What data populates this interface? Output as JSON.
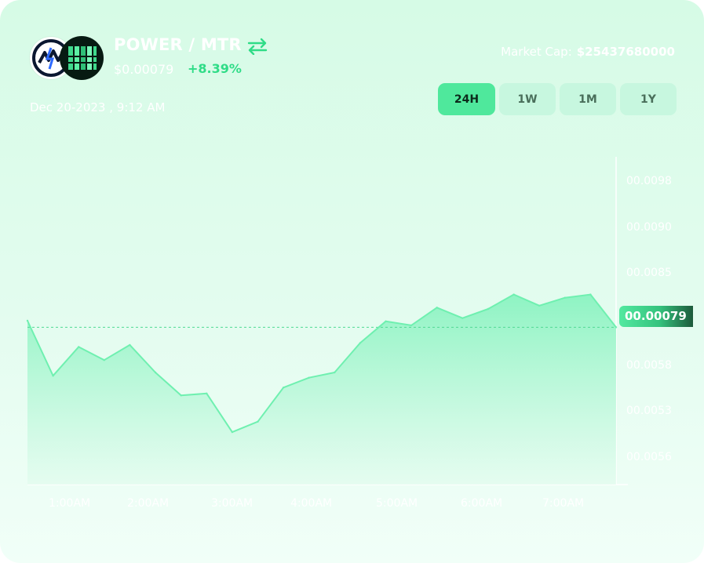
{
  "header": {
    "pair": "POWER / MTR",
    "price": "$0.00079",
    "change": "+8.39%",
    "date": "Dec 20-2023 , 9:12 AM",
    "market_cap_label": "Market Cap:",
    "market_cap_value": "$25437680000"
  },
  "icons": {
    "swap": "swap-arrows-icon",
    "token_a": "meter-token-icon",
    "token_b": "power-token-icon"
  },
  "timeframes": [
    {
      "label": "24H",
      "active": true
    },
    {
      "label": "1W",
      "active": false
    },
    {
      "label": "1M",
      "active": false
    },
    {
      "label": "1Y",
      "active": false
    }
  ],
  "colors": {
    "accent": "#2fdc87",
    "line": "#6ff0b0",
    "area_top": "#7ff2bb",
    "area_bottom": "#dffbec",
    "active_tab": "#4fe89c",
    "inactive_tab": "#c7f7df"
  },
  "chart_data": {
    "type": "area",
    "y_ticks": [
      "00.0098",
      "00.0090",
      "00.0085",
      "00.0058",
      "00.0053",
      "00.0056"
    ],
    "x_ticks": [
      "1:00AM",
      "2:00AM",
      "3:00AM",
      "4:00AM",
      "5:00AM",
      "6:00AM",
      "7:00AM"
    ],
    "current_value_label": "00.00079",
    "series": [
      {
        "values": [
          0.008,
          0.00716,
          0.0076,
          0.0074,
          0.00763,
          0.00721,
          0.00686,
          0.00689,
          0.0063,
          0.00646,
          0.00698,
          0.00713,
          0.00721,
          0.00766,
          0.00799,
          0.00793,
          0.0082,
          0.00804,
          0.00818,
          0.0084,
          0.00823,
          0.00835,
          0.0084,
          0.0079
        ]
      }
    ],
    "current_value": 0.0079,
    "ylim": [
      0.0055,
      0.0105
    ],
    "grid": false
  }
}
